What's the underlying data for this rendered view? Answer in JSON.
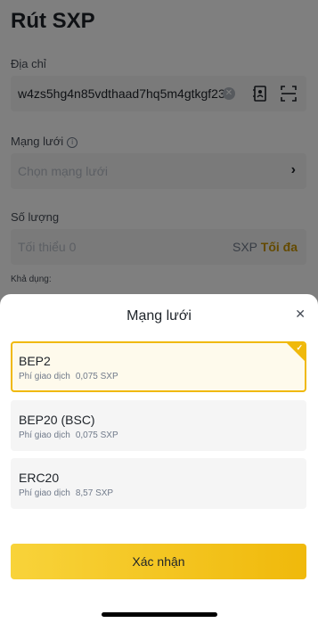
{
  "page": {
    "title": "Rút SXP",
    "address": {
      "label": "Địa chỉ",
      "value": "w4zs5hg4n85vdthaad7hq5m4gtkgf23"
    },
    "network": {
      "label": "Mạng lưới",
      "placeholder": "Chọn mạng lưới"
    },
    "amount": {
      "label": "Số lượng",
      "placeholder": "Tối thiểu 0",
      "unit": "SXP",
      "max_label": "Tối đa"
    },
    "available_label": "Khả dụng:"
  },
  "sheet": {
    "title": "Mạng lưới",
    "fee_label": "Phí giao dịch",
    "options": [
      {
        "name": "BEP2",
        "fee": "0,075 SXP",
        "selected": true
      },
      {
        "name": "BEP20 (BSC)",
        "fee": "0,075 SXP",
        "selected": false
      },
      {
        "name": "ERC20",
        "fee": "8,57 SXP",
        "selected": false
      }
    ],
    "confirm_label": "Xác nhận"
  },
  "colors": {
    "accent": "#f0b90b",
    "max_text": "#c99400",
    "overlay": "rgba(0,0,0,0.5)"
  },
  "icons": [
    "clear-icon",
    "address-book-icon",
    "scan-icon",
    "info-icon",
    "chevron-right-icon",
    "close-icon",
    "check-icon"
  ]
}
